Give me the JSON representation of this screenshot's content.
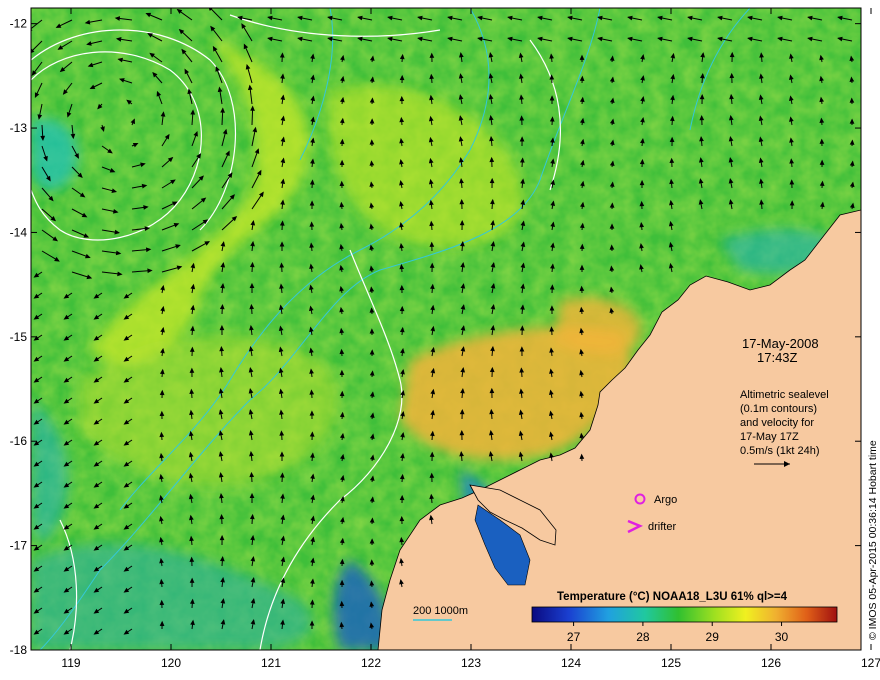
{
  "map": {
    "lon_range": [
      118.6,
      126.9
    ],
    "lat_range": [
      -18,
      -11.85
    ],
    "lon_ticks": [
      119,
      120,
      121,
      122,
      123,
      124,
      125,
      126,
      127
    ],
    "lat_ticks": [
      -12,
      -13,
      -14,
      -15,
      -16,
      -17,
      -18
    ]
  },
  "annotations": {
    "date": "17-May-2008",
    "time": "17:43Z",
    "altimetry_lines": [
      "Altimetric sealevel",
      "(0.1m contours)",
      "and velocity for",
      "17-May 17Z",
      "0.5m/s (1kt 24h)"
    ],
    "argo_label": "Argo",
    "drifter_label": "drifter",
    "depth_label": "200  1000m",
    "credit": "© IMOS 05-Apr-2015 00:36:14 Hobart time"
  },
  "colorbar": {
    "title": "Temperature (°C) NOAA18_L3U 61% ql>=4",
    "range": [
      26.4,
      30.8
    ],
    "ticks": [
      "27",
      "28",
      "29",
      "30"
    ]
  },
  "colors": {
    "land": "#f7c9a0",
    "ocean_base": "#3fbf3a",
    "warm_patch": "#f2b43a",
    "cool_coast": "#1a4fb0",
    "argo": "#e020e0",
    "drifter": "#e020e0",
    "depth_contour": "#35c8d8",
    "sealevel_contour": "#ffffff"
  }
}
